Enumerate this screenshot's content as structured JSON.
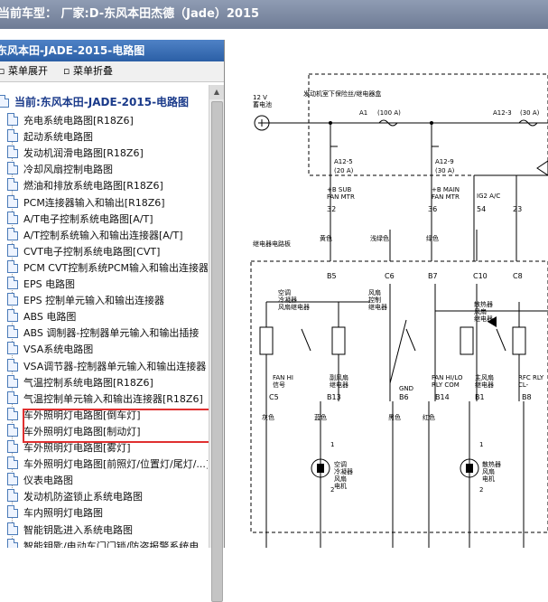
{
  "title": "当前车型：  厂家:D-东风本田杰德（Jade）2015",
  "left_panel": {
    "header": "东风本田-JADE-2015-电路图",
    "expand_label": "菜单展开",
    "collapse_label": "菜单折叠",
    "root_label": "当前:东风本田-JADE-2015-电路图",
    "items": [
      "充电系统电路图[R18Z6]",
      "起动系统电路图",
      "发动机润滑电路图[R18Z6]",
      "冷却风扇控制电路图",
      "燃油和排放系统电路图[R18Z6]",
      "PCM连接器输入和输出[R18Z6]",
      "A/T电子控制系统电路图[A/T]",
      "A/T控制系统输入和输出连接器[A/T]",
      "CVT电子控制系统电路图[CVT]",
      "PCM CVT控制系统PCM输入和输出连接器",
      "EPS 电路图",
      "EPS 控制单元输入和输出连接器",
      "ABS 电路图",
      "ABS 调制器-控制器单元输入和输出插接",
      "VSA系统电路图",
      "VSA调节器-控制器单元输入和输出连接器",
      "气温控制系统电路图[R18Z6]",
      "气温控制单元输入和输出连接器[R18Z6]",
      "车外照明灯电路图[倒车灯]",
      "车外照明灯电路图[制动灯]",
      "车外照明灯电路图[雾灯]",
      "车外照明灯电路图[前照灯/位置灯/尾灯/...]",
      "仪表电路图",
      "发动机防盗锁止系统电路图",
      "车内照明灯电路图",
      "智能钥匙进入系统电路图",
      "智能钥匙/电动车门门锁/防盗报警系统电..."
    ]
  },
  "diagram": {
    "battery": "12 V\n蓄电池",
    "fuse_box": "发动机室下保险丝/继电器盒",
    "fuse_a1": "A1",
    "fuse_a1_rating": "(100 A)",
    "fuse_a12_3": "A12-3",
    "fuse_a12_3_rating": "(30 A)",
    "fuse_a12_5": "A12-5",
    "fuse_a12_5_rating": "(20 A)",
    "fuse_a12_9": "A12-9",
    "fuse_a12_9_rating": "(30 A)",
    "sub_fan": "+B SUB\nFAN MTR",
    "main_fan": "+B MAIN\nFAN MTR",
    "ig2": "IG2 A/C",
    "relay_box": "继电器电路板",
    "wire_yellow": "黄色",
    "wire_lightgreen": "浅绿色",
    "wire_green": "绿色",
    "wire_gray": "灰色",
    "wire_blue": "蓝色",
    "wire_black": "黑色",
    "wire_red": "红色",
    "pins_top": [
      "32",
      "36",
      "54",
      "23"
    ],
    "pins_box": [
      "B5",
      "C6",
      "B7",
      "C10",
      "C8"
    ],
    "relay1": "空调\n冷凝器\n风扇继电器",
    "relay2": "风扇\n控制\n继电器",
    "relay3": "散热器\n风扇\n继电器",
    "fan_hi": "FAN HI\n信号",
    "sub_fan_relay": "副风扇\n继电器",
    "gnd": "GND",
    "fan_hilo": "FAN HI/LO\nRLY COM",
    "main_fan_relay": "主风扇\n继电器",
    "rfc_rly": "RFC RLY\nCL-",
    "pins_bottom": [
      "C5",
      "B13",
      "B6",
      "B14",
      "B1",
      "B8"
    ],
    "motor1": "空调\n冷凝器\n风扇\n电机",
    "motor2": "散热器\n风扇\n电机",
    "motor_pin_1": "1",
    "motor_pin_2": "2"
  }
}
